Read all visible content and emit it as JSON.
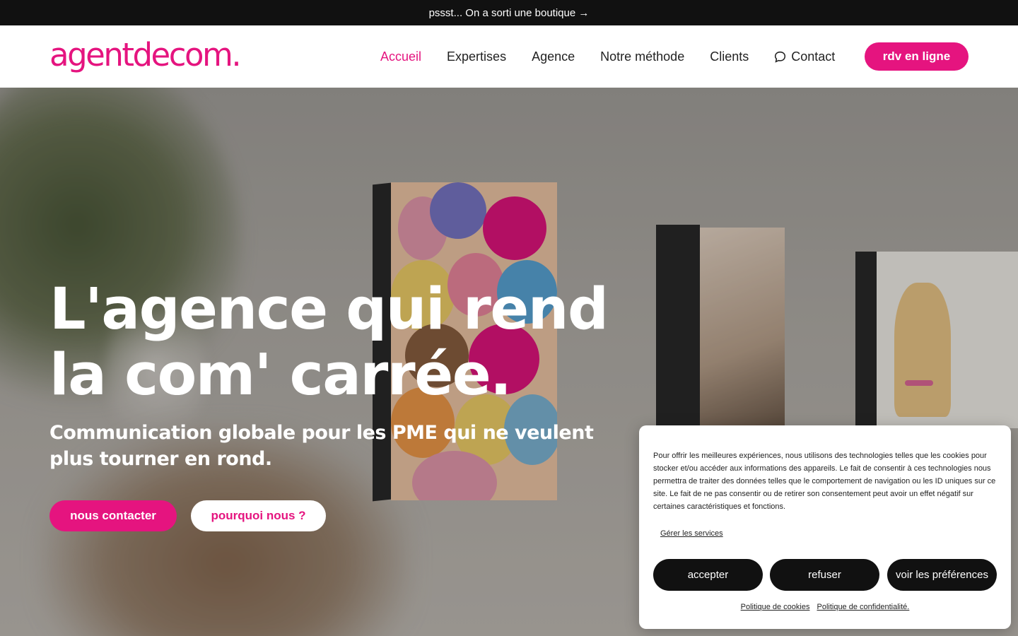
{
  "topbar": {
    "text": "pssst... On a sorti une boutique →"
  },
  "header": {
    "logo": "agentdecom.",
    "nav": [
      {
        "label": "Accueil",
        "active": true
      },
      {
        "label": "Expertises"
      },
      {
        "label": "Agence"
      },
      {
        "label": "Notre méthode"
      },
      {
        "label": "Clients"
      },
      {
        "label": "Contact",
        "icon": "chat-icon"
      }
    ],
    "cta": "rdv en ligne"
  },
  "hero": {
    "title_line1": "L'agence qui rend",
    "title_line2": "la com' carrée.",
    "subtitle": "Communication globale pour les PME qui ne veulent plus tourner en rond.",
    "btn_contact": "nous contacter",
    "btn_why": "pourquoi nous ?"
  },
  "cookie": {
    "text": "Pour offrir les meilleures expériences, nous utilisons des technologies telles que les cookies pour stocker et/ou accéder aux informations des appareils. Le fait de consentir à ces technologies nous permettra de traiter des données telles que le comportement de navigation ou les ID uniques sur ce site. Le fait de ne pas consentir ou de retirer son consentement peut avoir un effet négatif sur certaines caractéristiques et fonctions.",
    "manage": "Gérer les services",
    "accept": "accepter",
    "refuse": "refuser",
    "prefs": "voir les préférences",
    "cookie_policy": "Politique de cookies",
    "privacy_policy": "Politique de confidentialité."
  },
  "colors": {
    "brand": "#e5147f",
    "dark": "#111111"
  }
}
